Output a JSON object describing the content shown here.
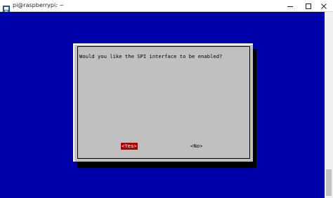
{
  "window": {
    "title": "pi@raspberrypi: ~",
    "minimize_label": "—",
    "maximize_label": "☐",
    "close_label": "✕"
  },
  "dialog": {
    "question": "Would you like the SPI interface to be enabled?",
    "yes_label": "<Yes>",
    "no_label": "<No>",
    "selected": "Yes"
  },
  "colors": {
    "terminal_bg": "#0000aa",
    "dialog_bg": "#c0c0c0",
    "selected_bg": "#aa0000"
  },
  "icons": [
    "terminal-app-icon",
    "minimize-icon",
    "maximize-icon",
    "close-icon"
  ]
}
